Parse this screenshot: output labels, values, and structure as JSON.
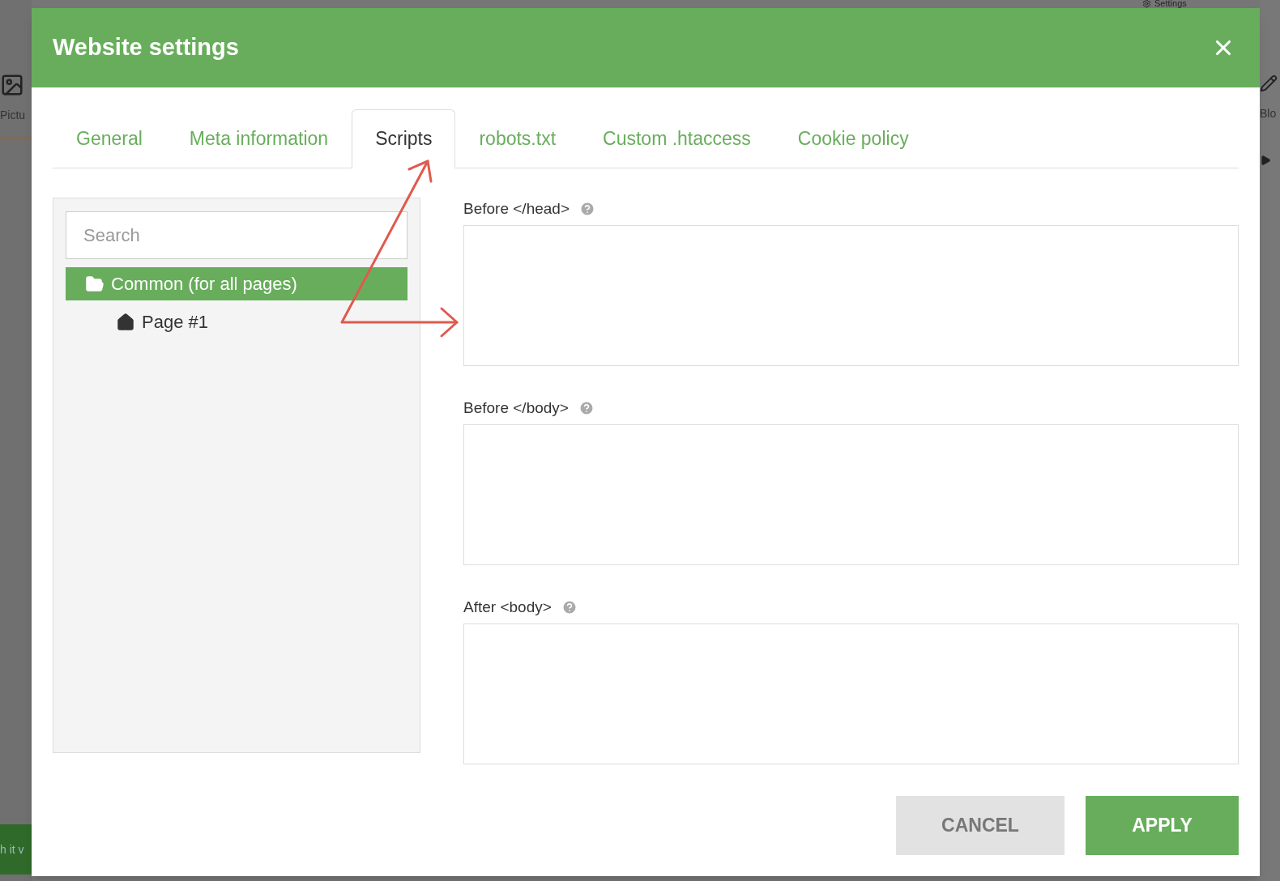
{
  "background": {
    "top_right_menu": "Settings",
    "left_label": "Pictu",
    "right_label": "Blo",
    "bottom_text": "h it v"
  },
  "dialog": {
    "title": "Website settings"
  },
  "tabs": [
    {
      "label": "General",
      "selected": false
    },
    {
      "label": "Meta information",
      "selected": false
    },
    {
      "label": "Scripts",
      "selected": true
    },
    {
      "label": "robots.txt",
      "selected": false
    },
    {
      "label": "Custom .htaccess",
      "selected": false
    },
    {
      "label": "Cookie policy",
      "selected": false
    }
  ],
  "search": {
    "placeholder": "Search"
  },
  "tree": [
    {
      "label": "Common (for all pages)",
      "kind": "folder",
      "selected": true,
      "children": [
        {
          "label": "Page #1",
          "kind": "home",
          "selected": false
        }
      ]
    }
  ],
  "fields": [
    {
      "label": "Before </head>"
    },
    {
      "label": "Before </body>"
    },
    {
      "label": "After <body>"
    }
  ],
  "buttons": [
    {
      "label": "CANCEL",
      "kind": "secondary"
    },
    {
      "label": "APPLY",
      "kind": "primary"
    }
  ]
}
